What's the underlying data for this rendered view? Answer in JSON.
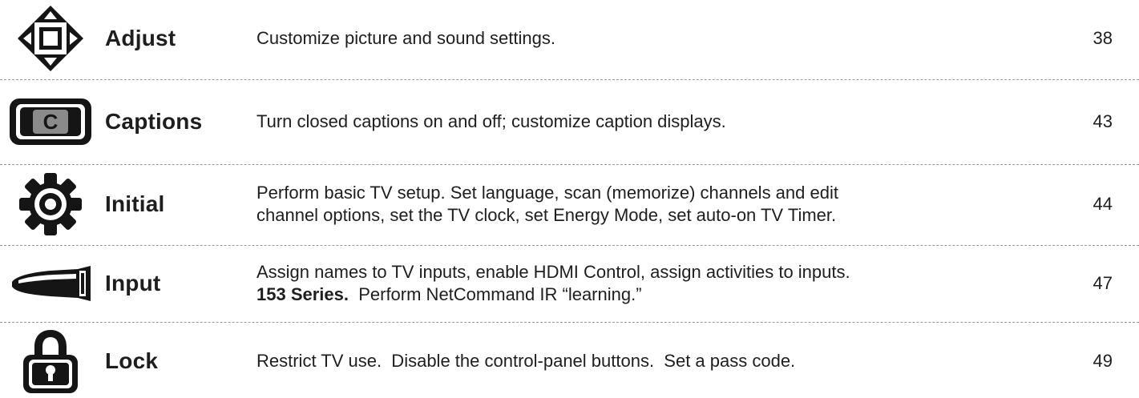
{
  "menu": {
    "rows": [
      {
        "icon": "adjust-arrows-icon",
        "name": "Adjust",
        "description": "Customize picture and sound settings.",
        "page": "38"
      },
      {
        "icon": "captions-c-icon",
        "name": "Captions",
        "description": "Turn closed captions on and off; customize caption displays.",
        "page": "43"
      },
      {
        "icon": "initial-gear-icon",
        "name": "Initial",
        "description_line1": "Perform basic TV setup.  Set language, scan (memorize) channels and edit",
        "description_line2": "channel options, set the TV clock, set Energy Mode, set auto-on TV Timer.",
        "page": "44"
      },
      {
        "icon": "input-connector-icon",
        "name": "Input",
        "description_line1": "Assign names to TV inputs, enable HDMI Control, assign activities to inputs.",
        "description_bold": "153 Series.",
        "description_line2_rest": "  Perform NetCommand IR “learning.”",
        "page": "47"
      },
      {
        "icon": "lock-padlock-icon",
        "name": "Lock",
        "description": "Restrict TV use.  Disable the control-panel buttons.  Set a pass code.",
        "page": "49"
      }
    ]
  }
}
